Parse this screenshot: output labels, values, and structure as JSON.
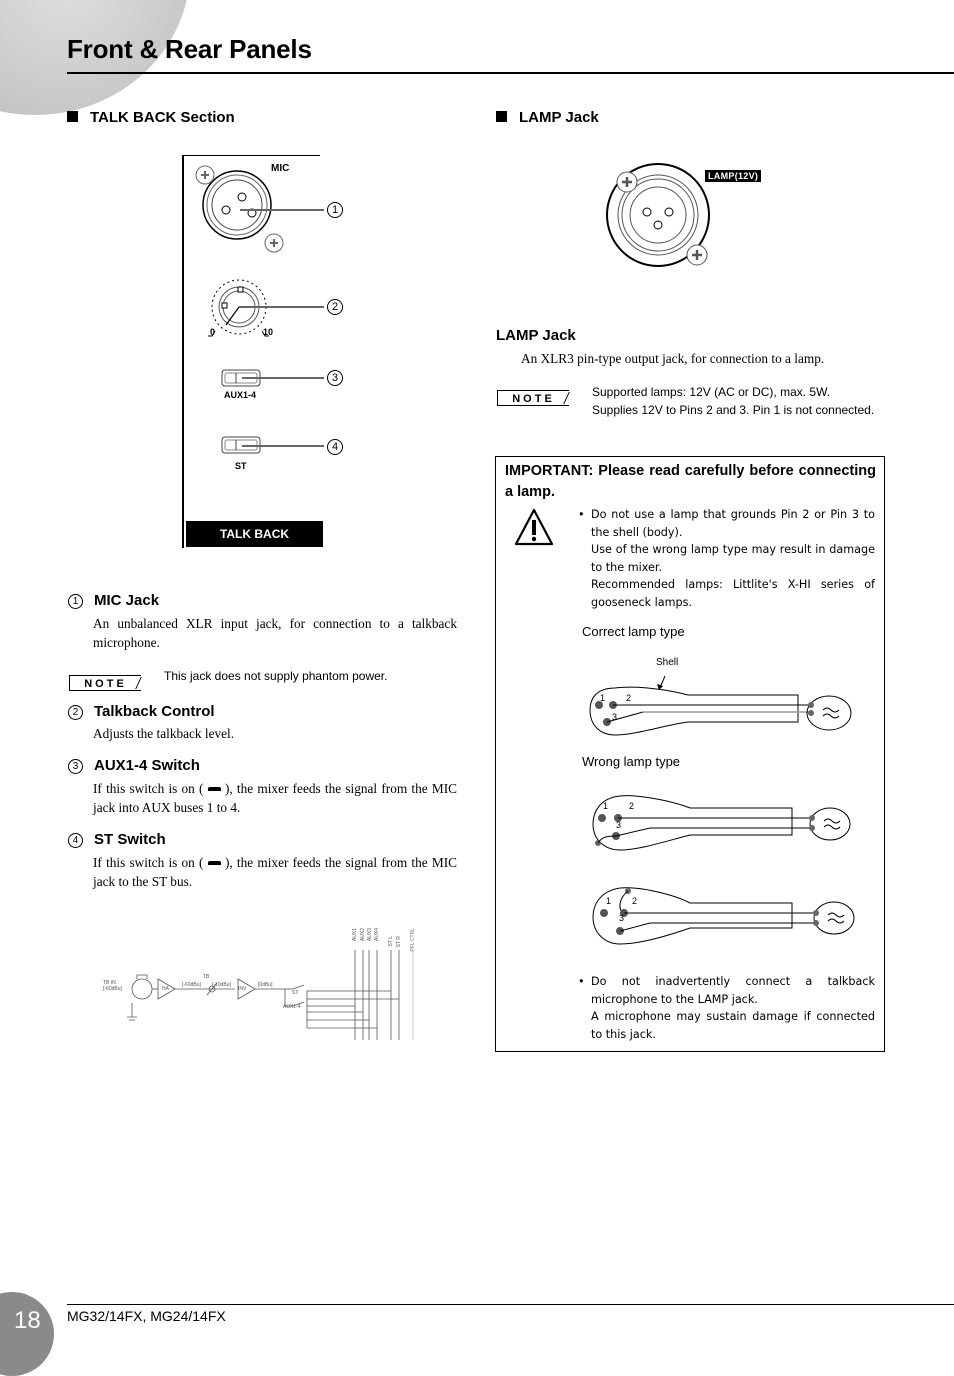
{
  "header": {
    "title": "Front & Rear Panels"
  },
  "talkback": {
    "section_title": "TALK BACK Section",
    "panel": {
      "mic_label": "MIC",
      "knob_min": "0",
      "knob_max": "10",
      "aux_label": "AUX1-4",
      "st_label": "ST",
      "bar_label": "TALK BACK",
      "callouts": [
        "1",
        "2",
        "3",
        "4"
      ]
    },
    "items": [
      {
        "num": "1",
        "title": "MIC Jack",
        "text": "An unbalanced XLR input jack, for connection to a talkback microphone."
      },
      {
        "num": "2",
        "title": "Talkback Control",
        "text": "Adjusts the talkback level."
      },
      {
        "num": "3",
        "title": "AUX1-4 Switch",
        "text_before": "If this switch is on (",
        "text_after": "), the mixer feeds the signal from the MIC jack into AUX buses 1 to 4."
      },
      {
        "num": "4",
        "title": "ST Switch",
        "text_before": "If this switch is on (",
        "text_after": "), the mixer feeds the signal from the MIC jack to the ST bus."
      }
    ],
    "note": {
      "badge": "NOTE",
      "text": "This jack does not supply phantom power."
    },
    "block_diagram": {
      "input_label": "TB IN",
      "input_level": "[-60dBu]",
      "ha_label": "HA",
      "level1": "[-60dBu]",
      "tb_label": "TB",
      "level2": "[-10dBu]",
      "inv_label": "INV",
      "level3": "[0dBu]",
      "st_switch": "ST",
      "aux_switch": "AUX1-4",
      "buses": [
        "AUX1",
        "AUX2",
        "AUX3",
        "AUX4",
        "ST L",
        "ST R",
        "PFL CTRL"
      ]
    }
  },
  "lamp": {
    "section_title": "LAMP Jack",
    "jack_label": "LAMP(12V)",
    "subtitle": "LAMP Jack",
    "text": "An XLR3 pin-type output jack, for connection to a lamp.",
    "note": {
      "badge": "NOTE",
      "line1": "Supported lamps: 12V (AC or DC), max. 5W.",
      "line2": "Supplies 12V to Pins 2 and 3. Pin 1 is not connected."
    },
    "important": {
      "title": "IMPORTANT: Please read carefully before connecting a lamp.",
      "bullet1": {
        "line1": "Do not use a lamp that grounds Pin 2 or Pin 3 to the shell (body).",
        "line2": "Use of the wrong lamp type may result in damage to the mixer.",
        "line3": "Recommended lamps: Littlite's X-HI series of gooseneck lamps."
      },
      "correct_label": "Correct lamp type",
      "shell_label": "Shell",
      "wrong_label": "Wrong lamp type",
      "pins": [
        "1",
        "2",
        "3"
      ],
      "bullet2": {
        "line1": "Do not inadvertently connect a talkback microphone to the LAMP jack.",
        "line2": "A microphone may sustain damage if connected to this jack."
      }
    }
  },
  "footer": {
    "page_number": "18",
    "model": "MG32/14FX, MG24/14FX"
  }
}
